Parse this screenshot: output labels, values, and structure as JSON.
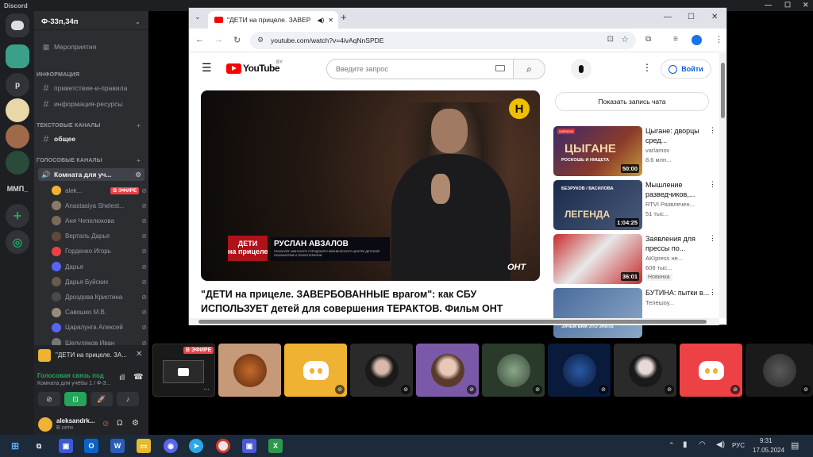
{
  "app": {
    "title": "Discord",
    "minimize": "—",
    "maximize": "☐",
    "close": "✕"
  },
  "server": {
    "name": "Ф-33п,34п",
    "events": "Мероприятия",
    "cat_info": "ИНФОРМАЦИЯ",
    "ch_rules": "приветствие-и-правила",
    "ch_res": "информация-ресурсы",
    "cat_text": "ТЕКСТОВЫЕ КАНАЛЫ",
    "ch_general": "общее",
    "cat_voice": "ГОЛОСОВЫЕ КАНАЛЫ",
    "voice_room": "Комната для уч...",
    "rail_label": "ММП_"
  },
  "voice_users": [
    {
      "name": "alek...",
      "live": "В ЭФИРЕ",
      "color": "#f0b232"
    },
    {
      "name": "Anastasiya Shelest...",
      "color": "#8a7a6a"
    },
    {
      "name": "Аня Чепелюкова",
      "color": "#7b6a5a"
    },
    {
      "name": "Верталь Дарья",
      "color": "#5c4a3c"
    },
    {
      "name": "Горденко Игорь",
      "color": "#ed4245"
    },
    {
      "name": "Дарья",
      "color": "#5865f2"
    },
    {
      "name": "Дарья Буйских",
      "color": "#6a5a4a"
    },
    {
      "name": "Дроздова Кристина",
      "color": "#4a4a4a"
    },
    {
      "name": "Савошко М.В.",
      "color": "#9a8a7a"
    },
    {
      "name": "Царалунга Алексей",
      "color": "#5865f2"
    },
    {
      "name": "Шелуляков Иван",
      "color": "#777"
    }
  ],
  "now_playing": "\"ДЕТИ на прицеле. ЗА...",
  "voice_status": {
    "title": "Голосовая связь под",
    "subtitle": "Комната для учёбы 1 / Ф-3..."
  },
  "user": {
    "name": "aleksandrk...",
    "status": "В сети"
  },
  "browser": {
    "tab_title": "\"ДЕТИ на прицеле. ЗАВЕР",
    "url": "youtube.com/watch?v=4ivAqNnSPDE"
  },
  "youtube": {
    "logo": "YouTube",
    "region": "BY",
    "search_placeholder": "Введите запрос",
    "signin": "Войти",
    "video_title": "\"ДЕТИ на прицеле. ЗАВЕРБОВАННЫЕ врагом\": как СБУ ИСПОЛЬЗУЕТ детей для совершения ТЕРАКТОВ. Фильм ОНТ",
    "chat_button": "Показать запись чата",
    "overlay_show": "ДЕТИ\nна прицеле",
    "overlay_name": "РУСЛАН АВЗАЛОВ",
    "overlay_role": "ПСИХОЛОГ МИНСКОГО ГОРОДСКОГО КЛИНИЧЕСКОГО ЦЕНТРА ДЕТСКОЙ ПСИХИАТРИИ И ПСИХОТЕРАПИИ",
    "channel_logo": "ОНТ"
  },
  "recommendations": [
    {
      "title": "Цыгане: дворцы сред...",
      "channel": "varlamov",
      "views": "8,6 млн...",
      "duration": "50:00",
      "thumb_text": "ЦЫГАНЕ",
      "thumb_sub": "РОСКОШЬ И НИЩЕТА",
      "thumb_badge": "varlamov"
    },
    {
      "title": "Мышление разведчиков,...",
      "channel": "RTVI Развлечен...",
      "views": "51 тыс...",
      "duration": "1:04:25",
      "thumb_text": "ЛЕГЕНДА",
      "thumb_sub": "БЕЗРУКОВ / ВАСИЛОВА"
    },
    {
      "title": "Заявления для прессы по...",
      "channel": "AKIpress не...",
      "views": "608 тыс...",
      "duration": "36:01",
      "badge": "Новинка"
    },
    {
      "title": "БУТИНА: пытки в...",
      "channel": "Телешоу...",
      "views": "",
      "duration": "",
      "thumb_sub": "ЗАЧЕМ ВАМ ЭТО ЗНАТЬ"
    }
  ],
  "stage": {
    "live": "В ЭФИРЕ"
  },
  "taskbar": {
    "lang": "РУС",
    "time": "9:31",
    "date": "17.05.2024"
  }
}
